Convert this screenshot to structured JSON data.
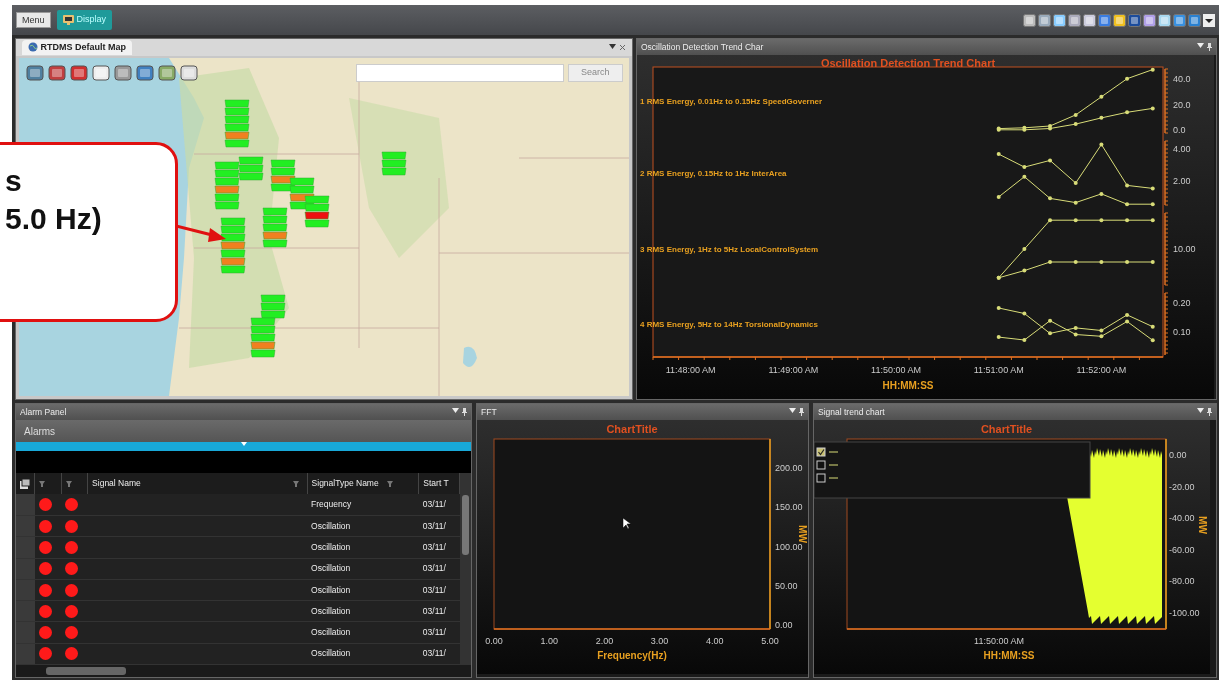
{
  "top_bar": {
    "menu_button": "Menu",
    "tabs": [
      {
        "label": "Display",
        "selected": true
      }
    ]
  },
  "map_panel": {
    "tab": "RTDMS Default Map",
    "search_button": "Search"
  },
  "callout": {
    "lines": [
      "s",
      "5.0 Hz)"
    ]
  },
  "trend_panel": {
    "title": "Oscillation Detection Trend Char",
    "chart_title": "Oscillation Detection Trend Chart",
    "xlabel": "HH:MM:SS",
    "xtick_labels": [
      "11:48:00 AM",
      "11:49:00 AM",
      "11:50:00 AM",
      "11:51:00 AM",
      "11:52:00 AM"
    ],
    "panels": [
      {
        "label": "1 RMS Energy, 0.01Hz to 0.15Hz SpeedGoverner",
        "ytick_labels": [
          "40.0",
          "20.0",
          "0.0"
        ]
      },
      {
        "label": "2 RMS Energy, 0.15Hz to 1Hz InterArea",
        "ytick_labels": [
          "4.00",
          "2.00"
        ]
      },
      {
        "label": "3 RMS Energy, 1Hz to 5Hz LocalControlSystem",
        "ytick_labels": [
          "10.00"
        ]
      },
      {
        "label": "4 RMS Energy, 5Hz to 14Hz TorsionalDynamics",
        "ytick_labels": [
          "0.20",
          "0.10"
        ]
      }
    ]
  },
  "alarm_panel": {
    "title": "Alarm Panel",
    "section": "Alarms",
    "columns": [
      "Signal Name",
      "SignalType Name",
      "Start T"
    ],
    "rows": [
      {
        "indicators": [
          {
            "color": "#ff1a1a"
          },
          {
            "color": "#ff1a1a"
          }
        ],
        "signal_type": "Frequency",
        "start": "03/11/"
      },
      {
        "indicators": [
          {
            "color": "#ff1a1a"
          },
          {
            "color": "#ff1a1a"
          }
        ],
        "signal_type": "Oscillation",
        "start": "03/11/"
      },
      {
        "indicators": [
          {
            "color": "#ff1a1a"
          },
          {
            "color": "#ff1a1a"
          }
        ],
        "signal_type": "Oscillation",
        "start": "03/11/"
      },
      {
        "indicators": [
          {
            "color": "#ff1a1a"
          },
          {
            "color": "#ff1a1a"
          }
        ],
        "signal_type": "Oscillation",
        "start": "03/11/"
      },
      {
        "indicators": [
          {
            "color": "#ff1a1a"
          },
          {
            "color": "#ff1a1a"
          }
        ],
        "signal_type": "Oscillation",
        "start": "03/11/"
      },
      {
        "indicators": [
          {
            "color": "#ff1a1a"
          },
          {
            "color": "#ff1a1a"
          }
        ],
        "signal_type": "Oscillation",
        "start": "03/11/"
      },
      {
        "indicators": [
          {
            "color": "#ff1a1a"
          },
          {
            "color": "#ff1a1a"
          }
        ],
        "signal_type": "Oscillation",
        "start": "03/11/"
      },
      {
        "indicators": [
          {
            "color": "#ff1a1a"
          },
          {
            "color": "#ff1a1a"
          }
        ],
        "signal_type": "Oscillation",
        "start": "03/11/"
      }
    ]
  },
  "fft_panel": {
    "title": "FFT",
    "chart_data": {
      "type": "line",
      "title": "ChartTitle",
      "xlabel": "Frequency(Hz)",
      "ylabel": "MW",
      "xlim": [
        0,
        5
      ],
      "ylim": [
        -5,
        237
      ],
      "xticks": [
        {
          "value": 0,
          "label": "0.00"
        },
        {
          "value": 1,
          "label": "1.00"
        },
        {
          "value": 2,
          "label": "2.00"
        },
        {
          "value": 3,
          "label": "3.00"
        },
        {
          "value": 4,
          "label": "4.00"
        },
        {
          "value": 5,
          "label": "5.00"
        }
      ],
      "yticks": [
        {
          "value": 0,
          "label": "0.00"
        },
        {
          "value": 50,
          "label": "50.00"
        },
        {
          "value": 100,
          "label": "100.00"
        },
        {
          "value": 150,
          "label": "150.00"
        },
        {
          "value": 200,
          "label": "200.00"
        }
      ]
    }
  },
  "signal_panel": {
    "title": "Signal trend chart",
    "chart_title": "ChartTitle",
    "legend": [
      {
        "checked": true
      },
      {
        "checked": false
      },
      {
        "checked": false
      }
    ],
    "ytick_labels": [
      "0.00",
      "-20.00",
      "-40.00",
      "-60.00",
      "-80.00",
      "-100.00"
    ],
    "ylabel": "MW",
    "xtick_label": "11:50:00 AM",
    "xlabel": "HH:MM:SS"
  }
}
